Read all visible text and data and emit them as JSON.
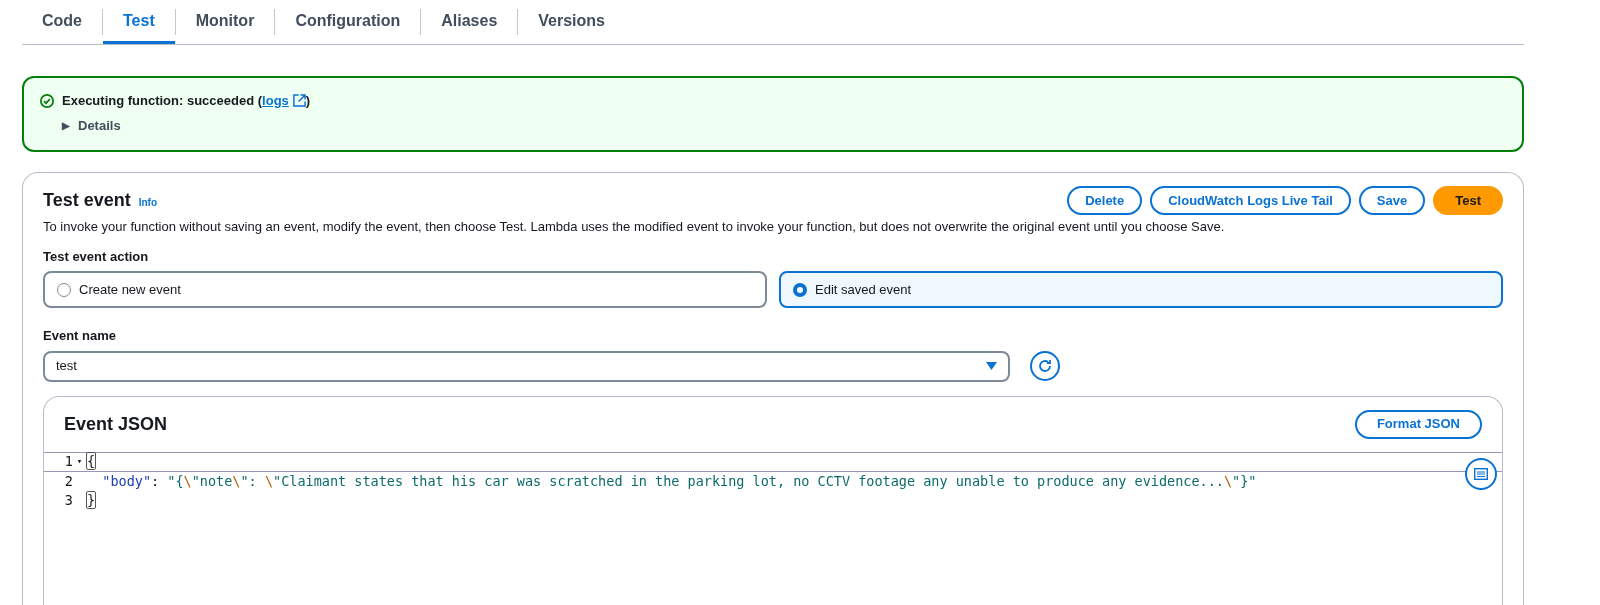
{
  "tabs": [
    {
      "label": "Code",
      "selected": false
    },
    {
      "label": "Test",
      "selected": true
    },
    {
      "label": "Monitor",
      "selected": false
    },
    {
      "label": "Configuration",
      "selected": false
    },
    {
      "label": "Aliases",
      "selected": false
    },
    {
      "label": "Versions",
      "selected": false
    }
  ],
  "alert": {
    "kind": "success",
    "message": "Executing function: succeeded (",
    "link": "logs",
    "message_end": ")",
    "details": {
      "label": "Details",
      "expanded": false,
      "toggle": "▶"
    }
  },
  "test_event": {
    "title": "Test event",
    "info": "Info",
    "description": "To invoke your function without saving an event, modify the event, then choose Test. Lambda uses the modified event to invoke your function, but does not overwrite the original event until you choose Save.",
    "buttons": [
      {
        "label": "Delete",
        "kind": "normal"
      },
      {
        "label": "CloudWatch Logs Live Tail",
        "kind": "normal"
      },
      {
        "label": "Save",
        "kind": "normal"
      },
      {
        "label": "Test",
        "kind": "primary"
      }
    ],
    "action_label": "Test event action",
    "actions": [
      {
        "label": "Create new event",
        "selected": false
      },
      {
        "label": "Edit saved event",
        "selected": true
      }
    ],
    "event_name_label": "Event name",
    "event_name": "test"
  },
  "editor": {
    "title": "Event JSON",
    "format_button": "Format JSON",
    "lines": [
      {
        "number": "1",
        "fold": "▾",
        "active": true,
        "tokens": [
          {
            "kind": "bracket",
            "text": "{"
          }
        ]
      },
      {
        "number": "2",
        "active": false,
        "tokens": [
          {
            "kind": "key",
            "text": "  \"body\""
          },
          {
            "kind": "punct",
            "text": ": "
          },
          {
            "kind": "string",
            "text": "\"{"
          },
          {
            "kind": "escape",
            "text": "\\"
          },
          {
            "kind": "string",
            "text": "\"note"
          },
          {
            "kind": "escape",
            "text": "\\"
          },
          {
            "kind": "string",
            "text": "\": "
          },
          {
            "kind": "escape",
            "text": "\\"
          },
          {
            "kind": "string",
            "text": "\"Claimant states that his car was scratched in the parking lot, no CCTV footage any unable to produce any evidence..."
          },
          {
            "kind": "escape",
            "text": "\\"
          },
          {
            "kind": "string",
            "text": "\"}\""
          }
        ]
      },
      {
        "number": "3",
        "active": false,
        "tokens": [
          {
            "kind": "bracket",
            "text": "}"
          }
        ]
      }
    ]
  }
}
